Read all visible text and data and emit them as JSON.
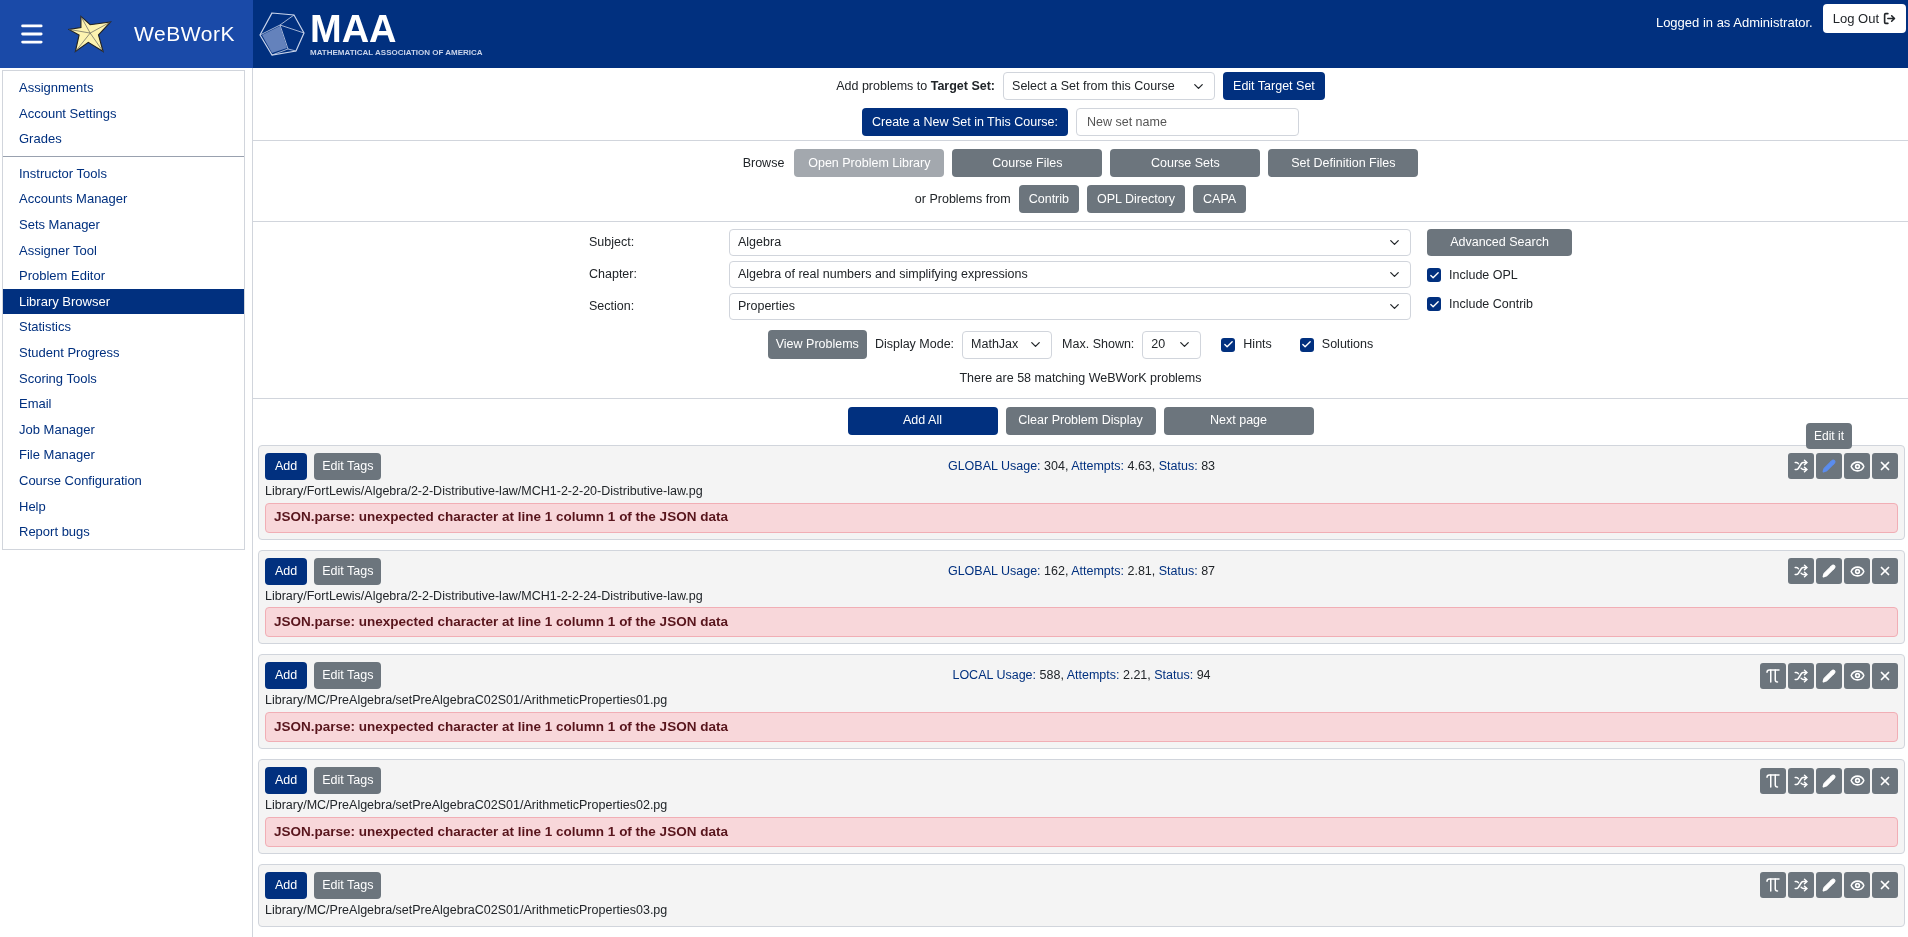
{
  "header": {
    "brand": "WeBWorK",
    "org_title": "MAA",
    "org_subtitle": "MATHEMATICAL ASSOCIATION OF AMERICA",
    "user_text": "Logged in as Administrator.",
    "logout": "Log Out"
  },
  "sidebar": {
    "groups": [
      [
        {
          "label": "Assignments",
          "selected": false
        },
        {
          "label": "Account Settings",
          "selected": false
        },
        {
          "label": "Grades",
          "selected": false
        }
      ],
      [
        {
          "label": "Instructor Tools",
          "selected": false
        },
        {
          "label": "Accounts Manager",
          "selected": false
        },
        {
          "label": "Sets Manager",
          "selected": false
        },
        {
          "label": "Assigner Tool",
          "selected": false
        },
        {
          "label": "Problem Editor",
          "selected": false
        },
        {
          "label": "Library Browser",
          "selected": true
        },
        {
          "label": "Statistics",
          "selected": false
        },
        {
          "label": "Student Progress",
          "selected": false
        },
        {
          "label": "Scoring Tools",
          "selected": false
        },
        {
          "label": "Email",
          "selected": false
        },
        {
          "label": "Job Manager",
          "selected": false
        },
        {
          "label": "File Manager",
          "selected": false
        },
        {
          "label": "Course Configuration",
          "selected": false
        },
        {
          "label": "Help",
          "selected": false
        },
        {
          "label": "Report bugs",
          "selected": false
        }
      ]
    ]
  },
  "target": {
    "label": "Add problems to **Target Set:**",
    "select": "Select a Set from this Course",
    "edit_button": "Edit Target Set",
    "create_button": "Create a New Set in This Course:",
    "new_set_placeholder": "New set name"
  },
  "browse": {
    "label": "Browse",
    "buttons": [
      {
        "label": "Open Problem Library",
        "disabled": true
      },
      {
        "label": "Course Files",
        "disabled": false
      },
      {
        "label": "Course Sets",
        "disabled": false
      },
      {
        "label": "Set Definition Files",
        "disabled": false
      }
    ],
    "from_label": "or Problems from",
    "from_buttons": [
      "Contrib",
      "OPL Directory",
      "CAPA"
    ]
  },
  "search": {
    "fields": [
      {
        "label": "Subject:",
        "value": "Algebra"
      },
      {
        "label": "Chapter:",
        "value": "Algebra of real numbers and simplifying expressions"
      },
      {
        "label": "Section:",
        "value": "Properties"
      }
    ],
    "advanced": "Advanced Search",
    "includes": [
      {
        "label": "Include OPL",
        "checked": true
      },
      {
        "label": "Include Contrib",
        "checked": true
      }
    ],
    "view_button": "View Problems",
    "display_label": "Display Mode:",
    "display_value": "MathJax",
    "max_label": "Max. Shown:",
    "max_value": "20",
    "options": [
      {
        "label": "Hints",
        "checked": true
      },
      {
        "label": "Solutions",
        "checked": true
      }
    ],
    "result": "There are 58 matching WeBWorK problems"
  },
  "actions": {
    "add_all": "Add All",
    "clear": "Clear Problem Display",
    "next": "Next page"
  },
  "problems": [
    {
      "add": "Add",
      "edit_tags": "Edit Tags",
      "stats": [
        {
          "label": "GLOBAL Usage:",
          "value": "304,"
        },
        {
          "label": "Attempts:",
          "value": "4.63,"
        },
        {
          "label": "Status:",
          "value": "83"
        }
      ],
      "path": "Library/FortLewis/Algebra/2-2-Distributive-law/MCH1-2-2-20-Distributive-law.pg",
      "error": "JSON.parse: unexpected character at line 1 column 1 of the JSON data",
      "tooltip": "Edit it",
      "tools": [
        {
          "kind": "shuffle",
          "hovered": false
        },
        {
          "kind": "edit",
          "hovered": true
        },
        {
          "kind": "view",
          "hovered": false
        },
        {
          "kind": "remove",
          "hovered": false
        }
      ]
    },
    {
      "add": "Add",
      "edit_tags": "Edit Tags",
      "stats": [
        {
          "label": "GLOBAL Usage:",
          "value": "162,"
        },
        {
          "label": "Attempts:",
          "value": "2.81,"
        },
        {
          "label": "Status:",
          "value": "87"
        }
      ],
      "path": "Library/FortLewis/Algebra/2-2-Distributive-law/MCH1-2-2-24-Distributive-law.pg",
      "error": "JSON.parse: unexpected character at line 1 column 1 of the JSON data",
      "tools": [
        {
          "kind": "shuffle",
          "hovered": false
        },
        {
          "kind": "edit",
          "hovered": false
        },
        {
          "kind": "view",
          "hovered": false
        },
        {
          "kind": "remove",
          "hovered": false
        }
      ]
    },
    {
      "add": "Add",
      "edit_tags": "Edit Tags",
      "stats": [
        {
          "label": "LOCAL Usage:",
          "value": "588,"
        },
        {
          "label": "Attempts:",
          "value": "2.21,"
        },
        {
          "label": "Status:",
          "value": "94"
        }
      ],
      "path": "Library/MC/PreAlgebra/setPreAlgebraC02S01/ArithmeticProperties01.pg",
      "error": "JSON.parse: unexpected character at line 1 column 1 of the JSON data",
      "tools": [
        {
          "kind": "pi",
          "hovered": false
        },
        {
          "kind": "shuffle",
          "hovered": false
        },
        {
          "kind": "edit",
          "hovered": false
        },
        {
          "kind": "view",
          "hovered": false
        },
        {
          "kind": "remove",
          "hovered": false
        }
      ]
    },
    {
      "add": "Add",
      "edit_tags": "Edit Tags",
      "path": "Library/MC/PreAlgebra/setPreAlgebraC02S01/ArithmeticProperties02.pg",
      "error": "JSON.parse: unexpected character at line 1 column 1 of the JSON data",
      "tools": [
        {
          "kind": "pi",
          "hovered": false
        },
        {
          "kind": "shuffle",
          "hovered": false
        },
        {
          "kind": "edit",
          "hovered": false
        },
        {
          "kind": "view",
          "hovered": false
        },
        {
          "kind": "remove",
          "hovered": false
        }
      ]
    },
    {
      "add": "Add",
      "edit_tags": "Edit Tags",
      "path": "Library/MC/PreAlgebra/setPreAlgebraC02S01/ArithmeticProperties03.pg",
      "tools": [
        {
          "kind": "pi",
          "hovered": false
        },
        {
          "kind": "shuffle",
          "hovered": false
        },
        {
          "kind": "edit",
          "hovered": false
        },
        {
          "kind": "view",
          "hovered": false
        },
        {
          "kind": "remove",
          "hovered": false
        }
      ]
    }
  ]
}
